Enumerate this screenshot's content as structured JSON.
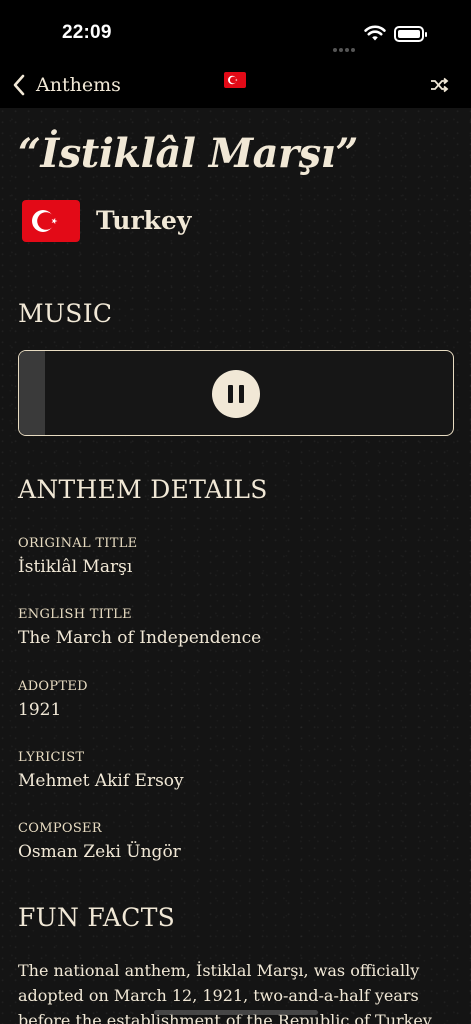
{
  "status_bar": {
    "time": "22:09"
  },
  "nav": {
    "back_label": "Anthems",
    "icons": [
      "chevron-left-icon",
      "turkey-flag-icon",
      "shuffle-icon"
    ]
  },
  "anthem": {
    "title": "“İstiklâl Marşı”",
    "country": "Turkey"
  },
  "music": {
    "heading": "MUSIC",
    "state": "playing",
    "progress": 0.06
  },
  "details": {
    "heading": "ANTHEM DETAILS",
    "items": [
      {
        "label": "ORIGINAL TITLE",
        "value": "İstiklâl Marşı"
      },
      {
        "label": "ENGLISH TITLE",
        "value": "The March of Independence"
      },
      {
        "label": "ADOPTED",
        "value": "1921"
      },
      {
        "label": "LYRICIST",
        "value": "Mehmet Akif Ersoy"
      },
      {
        "label": "COMPOSER",
        "value": "Osman Zeki Üngör"
      }
    ]
  },
  "fun_facts": {
    "heading": "FUN FACTS",
    "text": "The national anthem, İstiklal Marşı, was officially adopted on March 12, 1921, two-and-a-half years before the establishment of the Republic of Turkey"
  },
  "colors": {
    "background": "#141414",
    "text": "#f1e8d6",
    "flag_red": "#e30a17"
  }
}
